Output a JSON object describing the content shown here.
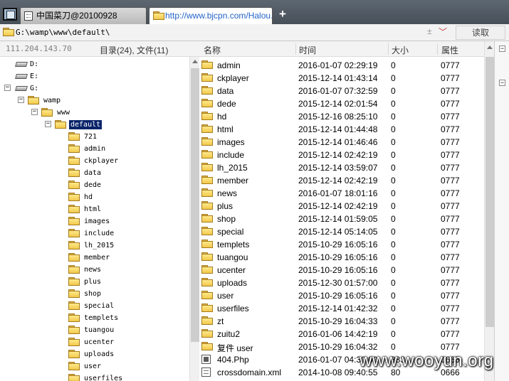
{
  "tabs": [
    {
      "label": "中国菜刀@20100928"
    },
    {
      "label": "http://www.bjcpn.com/Halou..."
    }
  ],
  "address": {
    "path": "G:\\wamp\\www\\default\\",
    "plus_minus": "±",
    "read_label": "读取"
  },
  "left_header": {
    "ip": "111.204.143.70",
    "counts": "目录(24), 文件(11)"
  },
  "tree": [
    {
      "label": "D:",
      "type": "drive",
      "level": 0,
      "expander": ""
    },
    {
      "label": "E:",
      "type": "drive",
      "level": 0,
      "expander": ""
    },
    {
      "label": "G:",
      "type": "drive",
      "level": 0,
      "expander": "−"
    },
    {
      "label": "wamp",
      "type": "folder",
      "level": 1,
      "expander": "−"
    },
    {
      "label": "www",
      "type": "folder",
      "level": 2,
      "expander": "−"
    },
    {
      "label": "default",
      "type": "folder",
      "level": 3,
      "expander": "−",
      "selected": true
    },
    {
      "label": "721",
      "type": "folder",
      "level": 4,
      "expander": ""
    },
    {
      "label": "admin",
      "type": "folder",
      "level": 4,
      "expander": ""
    },
    {
      "label": "ckplayer",
      "type": "folder",
      "level": 4,
      "expander": ""
    },
    {
      "label": "data",
      "type": "folder",
      "level": 4,
      "expander": ""
    },
    {
      "label": "dede",
      "type": "folder",
      "level": 4,
      "expander": ""
    },
    {
      "label": "hd",
      "type": "folder",
      "level": 4,
      "expander": ""
    },
    {
      "label": "html",
      "type": "folder",
      "level": 4,
      "expander": ""
    },
    {
      "label": "images",
      "type": "folder",
      "level": 4,
      "expander": ""
    },
    {
      "label": "include",
      "type": "folder",
      "level": 4,
      "expander": ""
    },
    {
      "label": "lh_2015",
      "type": "folder",
      "level": 4,
      "expander": ""
    },
    {
      "label": "member",
      "type": "folder",
      "level": 4,
      "expander": ""
    },
    {
      "label": "news",
      "type": "folder",
      "level": 4,
      "expander": ""
    },
    {
      "label": "plus",
      "type": "folder",
      "level": 4,
      "expander": ""
    },
    {
      "label": "shop",
      "type": "folder",
      "level": 4,
      "expander": ""
    },
    {
      "label": "special",
      "type": "folder",
      "level": 4,
      "expander": ""
    },
    {
      "label": "templets",
      "type": "folder",
      "level": 4,
      "expander": ""
    },
    {
      "label": "tuangou",
      "type": "folder",
      "level": 4,
      "expander": ""
    },
    {
      "label": "ucenter",
      "type": "folder",
      "level": 4,
      "expander": ""
    },
    {
      "label": "uploads",
      "type": "folder",
      "level": 4,
      "expander": ""
    },
    {
      "label": "user",
      "type": "folder",
      "level": 4,
      "expander": ""
    },
    {
      "label": "userfiles",
      "type": "folder",
      "level": 4,
      "expander": ""
    }
  ],
  "columns": {
    "name": "名称",
    "time": "时间",
    "size": "大小",
    "perm": "属性"
  },
  "files": [
    {
      "name": "admin",
      "type": "folder",
      "time": "2016-01-07 02:29:19",
      "size": "0",
      "perm": "0777"
    },
    {
      "name": "ckplayer",
      "type": "folder",
      "time": "2015-12-14 01:43:14",
      "size": "0",
      "perm": "0777"
    },
    {
      "name": "data",
      "type": "folder",
      "time": "2016-01-07 07:32:59",
      "size": "0",
      "perm": "0777"
    },
    {
      "name": "dede",
      "type": "folder",
      "time": "2015-12-14 02:01:54",
      "size": "0",
      "perm": "0777"
    },
    {
      "name": "hd",
      "type": "folder",
      "time": "2015-12-16 08:25:10",
      "size": "0",
      "perm": "0777"
    },
    {
      "name": "html",
      "type": "folder",
      "time": "2015-12-14 01:44:48",
      "size": "0",
      "perm": "0777"
    },
    {
      "name": "images",
      "type": "folder",
      "time": "2015-12-14 01:46:46",
      "size": "0",
      "perm": "0777"
    },
    {
      "name": "include",
      "type": "folder",
      "time": "2015-12-14 02:42:19",
      "size": "0",
      "perm": "0777"
    },
    {
      "name": "lh_2015",
      "type": "folder",
      "time": "2015-12-14 03:59:07",
      "size": "0",
      "perm": "0777"
    },
    {
      "name": "member",
      "type": "folder",
      "time": "2015-12-14 02:42:19",
      "size": "0",
      "perm": "0777"
    },
    {
      "name": "news",
      "type": "folder",
      "time": "2016-01-07 18:01:16",
      "size": "0",
      "perm": "0777"
    },
    {
      "name": "plus",
      "type": "folder",
      "time": "2015-12-14 02:42:19",
      "size": "0",
      "perm": "0777"
    },
    {
      "name": "shop",
      "type": "folder",
      "time": "2015-12-14 01:59:05",
      "size": "0",
      "perm": "0777"
    },
    {
      "name": "special",
      "type": "folder",
      "time": "2015-12-14 05:14:05",
      "size": "0",
      "perm": "0777"
    },
    {
      "name": "templets",
      "type": "folder",
      "time": "2015-10-29 16:05:16",
      "size": "0",
      "perm": "0777"
    },
    {
      "name": "tuangou",
      "type": "folder",
      "time": "2015-10-29 16:05:16",
      "size": "0",
      "perm": "0777"
    },
    {
      "name": "ucenter",
      "type": "folder",
      "time": "2015-10-29 16:05:16",
      "size": "0",
      "perm": "0777"
    },
    {
      "name": "uploads",
      "type": "folder",
      "time": "2015-12-30 01:57:00",
      "size": "0",
      "perm": "0777"
    },
    {
      "name": "user",
      "type": "folder",
      "time": "2015-10-29 16:05:16",
      "size": "0",
      "perm": "0777"
    },
    {
      "name": "userfiles",
      "type": "folder",
      "time": "2015-12-14 01:42:32",
      "size": "0",
      "perm": "0777"
    },
    {
      "name": "zt",
      "type": "folder",
      "time": "2015-10-29 16:04:33",
      "size": "0",
      "perm": "0777"
    },
    {
      "name": "zuitu2",
      "type": "folder",
      "time": "2016-01-06 14:42:19",
      "size": "0",
      "perm": "0777"
    },
    {
      "name": "复件 user",
      "type": "folder",
      "time": "2015-10-29 16:04:32",
      "size": "0",
      "perm": "0777"
    },
    {
      "name": "404.Php",
      "type": "php",
      "time": "2016-01-07 04:30:00",
      "size": "383",
      "perm": "0666"
    },
    {
      "name": "crossdomain.xml",
      "type": "xml",
      "time": "2014-10-08 09:40:55",
      "size": "80",
      "perm": "0666"
    }
  ],
  "side_strip": [
    "−",
    "−"
  ],
  "watermark": "www.wooyun.org",
  "colors": {
    "selection": "#0a246a",
    "tab_active_text": "#2464c8",
    "dropdown": "#c83232"
  }
}
